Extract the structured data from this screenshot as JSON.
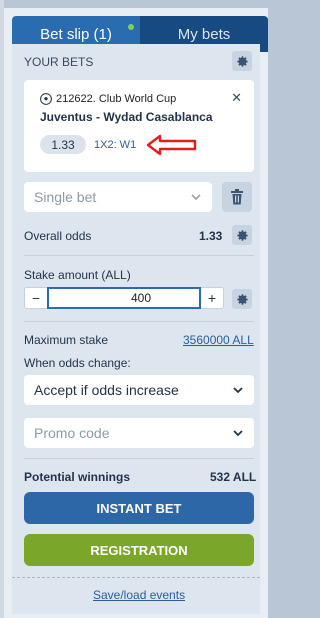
{
  "tabs": {
    "bet_slip": "Bet slip (1)",
    "my_bets": "My bets"
  },
  "your_bets": {
    "title": "YOUR BETS",
    "event": {
      "league": "212622. Club World Cup",
      "match": "Juventus - Wydad Casablanca",
      "odds": "1.33",
      "market": "1X2: W1"
    }
  },
  "bet_type": {
    "selected": "Single bet"
  },
  "overall_odds": {
    "label": "Overall odds",
    "value": "1.33"
  },
  "stake": {
    "label": "Stake amount (ALL)",
    "value": "400",
    "minus": "−",
    "plus": "+"
  },
  "max_stake": {
    "label": "Maximum stake",
    "value": "3560000 ALL"
  },
  "odds_change": {
    "label": "When odds change:",
    "selected": "Accept if odds increase"
  },
  "promo": {
    "placeholder": "Promo code"
  },
  "potential": {
    "label": "Potential winnings",
    "value": "532 ALL"
  },
  "buttons": {
    "instant_bet": "INSTANT BET",
    "registration": "REGISTRATION"
  },
  "save_load": "Save/load events",
  "colors": {
    "primary": "#2a6cb0",
    "tab_inactive": "#164a80",
    "registration": "#7aa72a",
    "instant_bet": "#2d67a8",
    "notification_dot": "#7cd15a",
    "annotation_arrow": "#e41b1b"
  },
  "icons": {
    "settings": "gear-icon",
    "ball": "soccer-ball-icon",
    "close": "close-icon",
    "delete": "trash-icon",
    "dropdown": "chevron-down-icon"
  }
}
